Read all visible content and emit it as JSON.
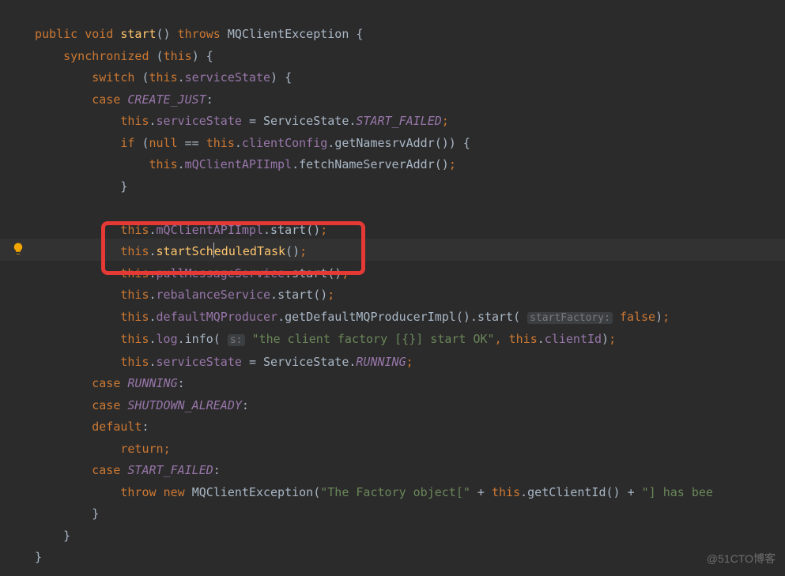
{
  "watermark": "@51CTO博客",
  "tokens": {
    "public": "public",
    "void": "void",
    "start": "start",
    "throws": "throws",
    "MQClientException": "MQClientException",
    "synchronized": "synchronized",
    "this": "this",
    "switch": "switch",
    "serviceState": "serviceState",
    "case": "case",
    "CREATE_JUST": "CREATE_JUST",
    "ServiceState": "ServiceState",
    "START_FAILED": "START_FAILED",
    "if": "if",
    "null": "null",
    "eqeq": "==",
    "clientConfig": "clientConfig",
    "getNamesrvAddr": "getNamesrvAddr",
    "mQClientAPIImpl": "mQClientAPIImpl",
    "fetchNameServerAddr": "fetchNameServerAddr",
    "startScheduledTask": "startScheduledTask",
    "pullMessageService": "pullMessageService",
    "rebalanceService": "rebalanceService",
    "defaultMQProducer": "defaultMQProducer",
    "getDefaultMQProducerImpl": "getDefaultMQProducerImpl",
    "hint_startFactory": "startFactory:",
    "false": "false",
    "log": "log",
    "info": "info",
    "hint_s": "s:",
    "str_clientfactory": "\"the client factory [{}] start OK\"",
    "clientId": "clientId",
    "RUNNING": "RUNNING",
    "SHUTDOWN_ALREADY": "SHUTDOWN_ALREADY",
    "default": "default",
    "return": "return",
    "throw": "throw",
    "new": "new",
    "str_factoryobj": "\"The Factory object[\"",
    "getClientId": "getClientId",
    "str_hasbee": "\"] has bee",
    "plus": " + "
  }
}
